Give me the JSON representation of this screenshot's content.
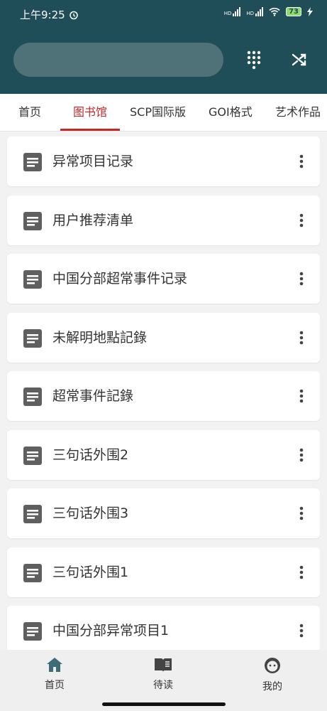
{
  "status_bar": {
    "time": "上午9:25",
    "network_1": "HD",
    "network_2": "HD",
    "battery": "73"
  },
  "search": {
    "placeholder": ""
  },
  "appbar": {
    "dialpad_icon": "dialpad-icon",
    "shuffle_icon": "shuffle-icon"
  },
  "tabs": [
    {
      "label": "首页",
      "active": false
    },
    {
      "label": "图书馆",
      "active": true
    },
    {
      "label": "SCP国际版",
      "active": false
    },
    {
      "label": "GOI格式",
      "active": false
    },
    {
      "label": "艺术作品",
      "active": false
    }
  ],
  "list": {
    "items": [
      {
        "title": "异常项目记录"
      },
      {
        "title": "用户推荐清单"
      },
      {
        "title": "中国分部超常事件记录"
      },
      {
        "title": "未解明地點記錄"
      },
      {
        "title": "超常事件記錄"
      },
      {
        "title": "三句话外围2"
      },
      {
        "title": "三句话外围3"
      },
      {
        "title": "三句话外围1"
      },
      {
        "title": "中国分部异常项目1"
      }
    ]
  },
  "bottom_nav": [
    {
      "label": "首页",
      "icon": "home-icon",
      "active": true
    },
    {
      "label": "待读",
      "icon": "book-icon",
      "active": false
    },
    {
      "label": "我的",
      "icon": "face-icon",
      "active": false
    }
  ],
  "colors": {
    "primary": "#1f4d58",
    "accent": "#c62828",
    "search_bg": "#4f7279",
    "background": "#f2f2f2"
  }
}
